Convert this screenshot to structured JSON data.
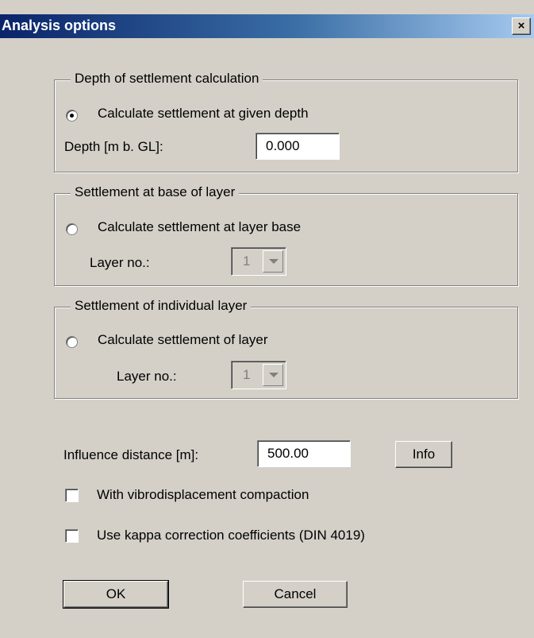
{
  "window": {
    "title": "Analysis options",
    "close_label": "×"
  },
  "group_depth": {
    "legend": "Depth of settlement calculation",
    "radio_label": "Calculate settlement at given depth",
    "radio_checked": true,
    "depth_label": "Depth [m b. GL]:",
    "depth_value": "0.000"
  },
  "group_base": {
    "legend": "Settlement at base of layer",
    "radio_label": "Calculate settlement at layer base",
    "layer_label": "Layer no.:",
    "layer_value": "1"
  },
  "group_individual": {
    "legend": "Settlement of individual layer",
    "radio_label": "Calculate settlement of layer",
    "layer_label": "Layer no.:",
    "layer_value": "1"
  },
  "influence": {
    "label": "Influence distance [m]:",
    "value": "500.00",
    "info_label": "Info"
  },
  "checkbox_vibro": {
    "label": "With vibrodisplacement compaction",
    "checked": false
  },
  "checkbox_kappa": {
    "label": "Use kappa correction coefficients (DIN 4019)",
    "checked": false
  },
  "buttons": {
    "ok": "OK",
    "cancel": "Cancel"
  }
}
